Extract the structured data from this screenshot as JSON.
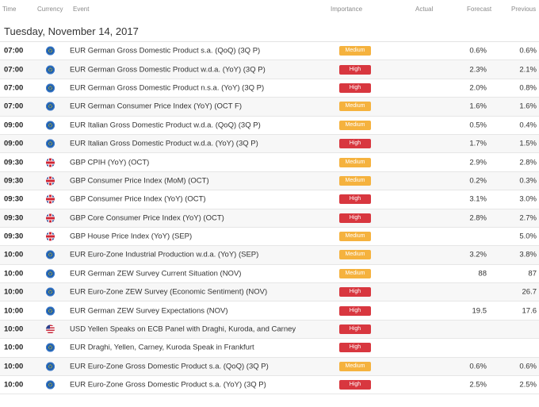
{
  "header": {
    "time": "Time",
    "currency": "Currency",
    "event": "Event",
    "importance": "Importance",
    "actual": "Actual",
    "forecast": "Forecast",
    "previous": "Previous"
  },
  "date_label": "Tuesday, November 14, 2017",
  "colors": {
    "medium": "#f5b23e",
    "high": "#d8373f"
  },
  "rows": [
    {
      "time": "07:00",
      "currency": "EUR",
      "flag_icon": "eu-flag-icon",
      "event": "EUR German Gross Domestic Product s.a. (QoQ) (3Q P)",
      "importance": "Medium",
      "actual": "",
      "forecast": "0.6%",
      "previous": "0.6%"
    },
    {
      "time": "07:00",
      "currency": "EUR",
      "flag_icon": "eu-flag-icon",
      "event": "EUR German Gross Domestic Product w.d.a. (YoY) (3Q P)",
      "importance": "High",
      "actual": "",
      "forecast": "2.3%",
      "previous": "2.1%"
    },
    {
      "time": "07:00",
      "currency": "EUR",
      "flag_icon": "eu-flag-icon",
      "event": "EUR German Gross Domestic Product n.s.a. (YoY) (3Q P)",
      "importance": "High",
      "actual": "",
      "forecast": "2.0%",
      "previous": "0.8%"
    },
    {
      "time": "07:00",
      "currency": "EUR",
      "flag_icon": "eu-flag-icon",
      "event": "EUR German Consumer Price Index (YoY) (OCT F)",
      "importance": "Medium",
      "actual": "",
      "forecast": "1.6%",
      "previous": "1.6%"
    },
    {
      "time": "09:00",
      "currency": "EUR",
      "flag_icon": "eu-flag-icon",
      "event": "EUR Italian Gross Domestic Product w.d.a. (QoQ) (3Q P)",
      "importance": "Medium",
      "actual": "",
      "forecast": "0.5%",
      "previous": "0.4%"
    },
    {
      "time": "09:00",
      "currency": "EUR",
      "flag_icon": "eu-flag-icon",
      "event": "EUR Italian Gross Domestic Product w.d.a. (YoY) (3Q P)",
      "importance": "High",
      "actual": "",
      "forecast": "1.7%",
      "previous": "1.5%"
    },
    {
      "time": "09:30",
      "currency": "GBP",
      "flag_icon": "uk-flag-icon",
      "event": "GBP CPIH (YoY) (OCT)",
      "importance": "Medium",
      "actual": "",
      "forecast": "2.9%",
      "previous": "2.8%"
    },
    {
      "time": "09:30",
      "currency": "GBP",
      "flag_icon": "uk-flag-icon",
      "event": "GBP Consumer Price Index (MoM) (OCT)",
      "importance": "Medium",
      "actual": "",
      "forecast": "0.2%",
      "previous": "0.3%"
    },
    {
      "time": "09:30",
      "currency": "GBP",
      "flag_icon": "uk-flag-icon",
      "event": "GBP Consumer Price Index (YoY) (OCT)",
      "importance": "High",
      "actual": "",
      "forecast": "3.1%",
      "previous": "3.0%"
    },
    {
      "time": "09:30",
      "currency": "GBP",
      "flag_icon": "uk-flag-icon",
      "event": "GBP Core Consumer Price Index (YoY) (OCT)",
      "importance": "High",
      "actual": "",
      "forecast": "2.8%",
      "previous": "2.7%"
    },
    {
      "time": "09:30",
      "currency": "GBP",
      "flag_icon": "uk-flag-icon",
      "event": "GBP House Price Index (YoY) (SEP)",
      "importance": "Medium",
      "actual": "",
      "forecast": "",
      "previous": "5.0%"
    },
    {
      "time": "10:00",
      "currency": "EUR",
      "flag_icon": "eu-flag-icon",
      "event": "EUR Euro-Zone Industrial Production w.d.a. (YoY) (SEP)",
      "importance": "Medium",
      "actual": "",
      "forecast": "3.2%",
      "previous": "3.8%"
    },
    {
      "time": "10:00",
      "currency": "EUR",
      "flag_icon": "eu-flag-icon",
      "event": "EUR German ZEW Survey Current Situation (NOV)",
      "importance": "Medium",
      "actual": "",
      "forecast": "88",
      "previous": "87"
    },
    {
      "time": "10:00",
      "currency": "EUR",
      "flag_icon": "eu-flag-icon",
      "event": "EUR Euro-Zone ZEW Survey (Economic Sentiment) (NOV)",
      "importance": "High",
      "actual": "",
      "forecast": "",
      "previous": "26.7"
    },
    {
      "time": "10:00",
      "currency": "EUR",
      "flag_icon": "eu-flag-icon",
      "event": "EUR German ZEW Survey Expectations (NOV)",
      "importance": "High",
      "actual": "",
      "forecast": "19.5",
      "previous": "17.6"
    },
    {
      "time": "10:00",
      "currency": "USD",
      "flag_icon": "us-flag-icon",
      "event": "USD Yellen Speaks on ECB Panel with Draghi, Kuroda, and Carney",
      "importance": "High",
      "actual": "",
      "forecast": "",
      "previous": ""
    },
    {
      "time": "10:00",
      "currency": "EUR",
      "flag_icon": "eu-flag-icon",
      "event": "EUR Draghi, Yellen, Carney, Kuroda Speak in Frankfurt",
      "importance": "High",
      "actual": "",
      "forecast": "",
      "previous": ""
    },
    {
      "time": "10:00",
      "currency": "EUR",
      "flag_icon": "eu-flag-icon",
      "event": "EUR Euro-Zone Gross Domestic Product s.a. (QoQ) (3Q P)",
      "importance": "Medium",
      "actual": "",
      "forecast": "0.6%",
      "previous": "0.6%"
    },
    {
      "time": "10:00",
      "currency": "EUR",
      "flag_icon": "eu-flag-icon",
      "event": "EUR Euro-Zone Gross Domestic Product s.a. (YoY) (3Q P)",
      "importance": "High",
      "actual": "",
      "forecast": "2.5%",
      "previous": "2.5%"
    }
  ]
}
